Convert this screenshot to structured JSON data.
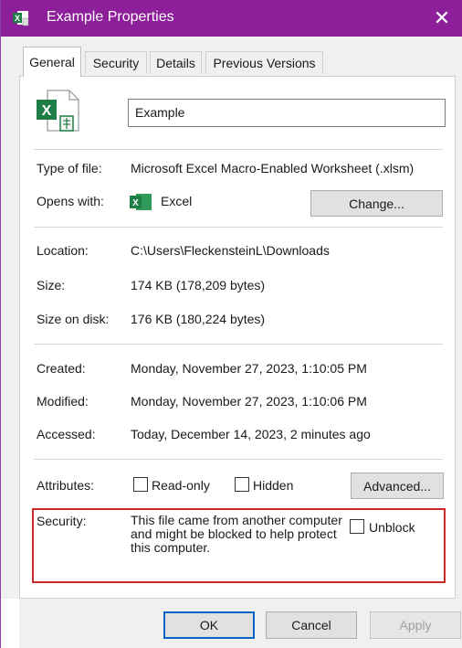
{
  "window": {
    "title": "Example Properties",
    "accent_color": "#8e1f9b",
    "close_glyph": "✕",
    "title_icon": "excel-file-icon"
  },
  "tabs": [
    {
      "label": "General",
      "active": true
    },
    {
      "label": "Security",
      "active": false
    },
    {
      "label": "Details",
      "active": false
    },
    {
      "label": "Previous Versions",
      "active": false
    }
  ],
  "general": {
    "file_name": "Example",
    "file_icon": "excel-macro-file-icon",
    "type_label": "Type of file:",
    "type_value": "Microsoft Excel Macro-Enabled Worksheet (.xlsm)",
    "opens_label": "Opens with:",
    "opens_icon": "excel-app-icon",
    "opens_value": "Excel",
    "change_button": "Change...",
    "location_label": "Location:",
    "location_value": "C:\\Users\\FleckensteinL\\Downloads",
    "size_label": "Size:",
    "size_value": "174 KB (178,209 bytes)",
    "size_disk_label": "Size on disk:",
    "size_disk_value": "176 KB (180,224 bytes)",
    "created_label": "Created:",
    "created_value": "Monday, November 27, 2023, 1:10:05 PM",
    "modified_label": "Modified:",
    "modified_value": "Monday, November 27, 2023, 1:10:06 PM",
    "accessed_label": "Accessed:",
    "accessed_value": "Today, December 14, 2023, 2 minutes ago",
    "attributes_label": "Attributes:",
    "readonly_label": "Read-only",
    "readonly_checked": false,
    "hidden_label": "Hidden",
    "hidden_checked": false,
    "advanced_button": "Advanced...",
    "security_label": "Security:",
    "security_text": "This file came from another computer and might be blocked to help protect this computer.",
    "unblock_label": "Unblock",
    "unblock_checked": false,
    "highlight_color": "#cc2b2b"
  },
  "footer": {
    "ok": "OK",
    "cancel": "Cancel",
    "apply": "Apply"
  }
}
